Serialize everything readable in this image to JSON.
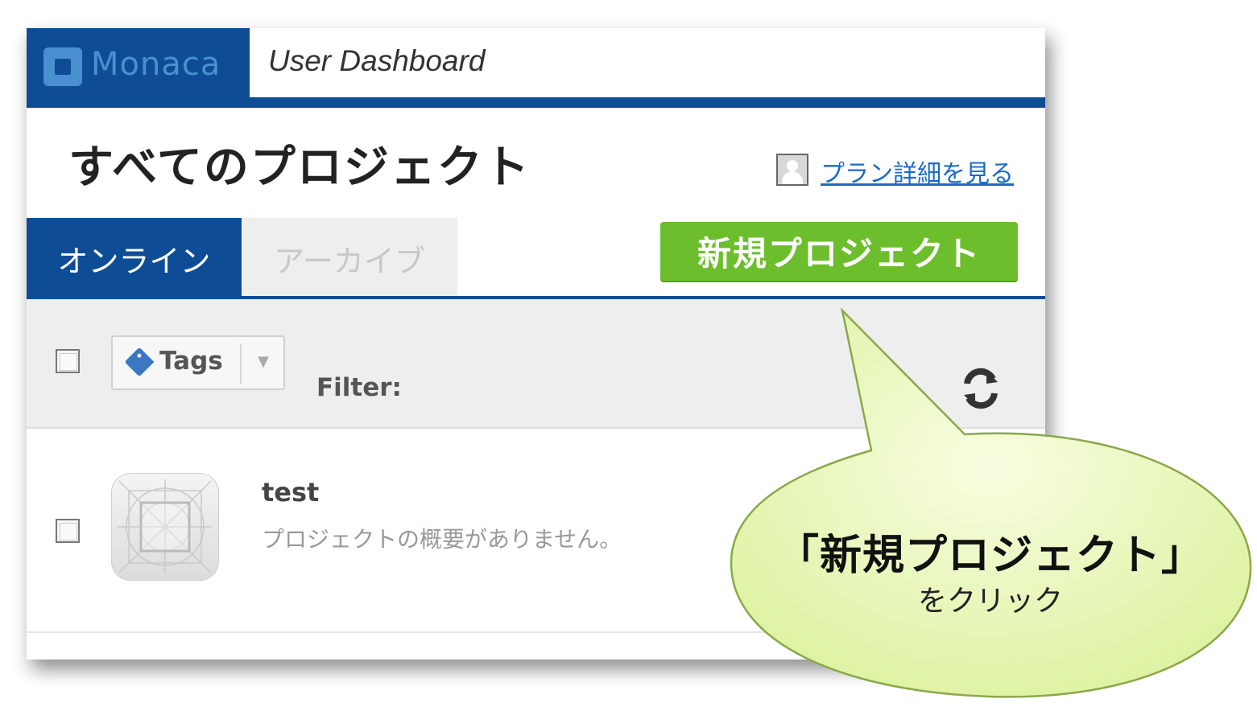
{
  "header": {
    "brand": "Monaca",
    "title": "User Dashboard"
  },
  "page": {
    "title": "すべてのプロジェクト",
    "plan_link": "プラン詳細を見る"
  },
  "tabs": [
    {
      "label": "オンライン",
      "active": true
    },
    {
      "label": "アーカイブ",
      "active": false
    }
  ],
  "actions": {
    "new_project": "新規プロジェクト"
  },
  "toolbar": {
    "tags_label": "Tags",
    "filter_label": "Filter:"
  },
  "projects": [
    {
      "name": "test",
      "description": "プロジェクトの概要がありません。"
    }
  ],
  "callout": {
    "title": "「新規プロジェクト」",
    "subtitle": "をクリック",
    "fill_color": "#e8f7b0"
  },
  "colors": {
    "brand_blue": "#0e4c96",
    "accent_green": "#6dbe2c",
    "link_blue": "#1a6ac8"
  }
}
